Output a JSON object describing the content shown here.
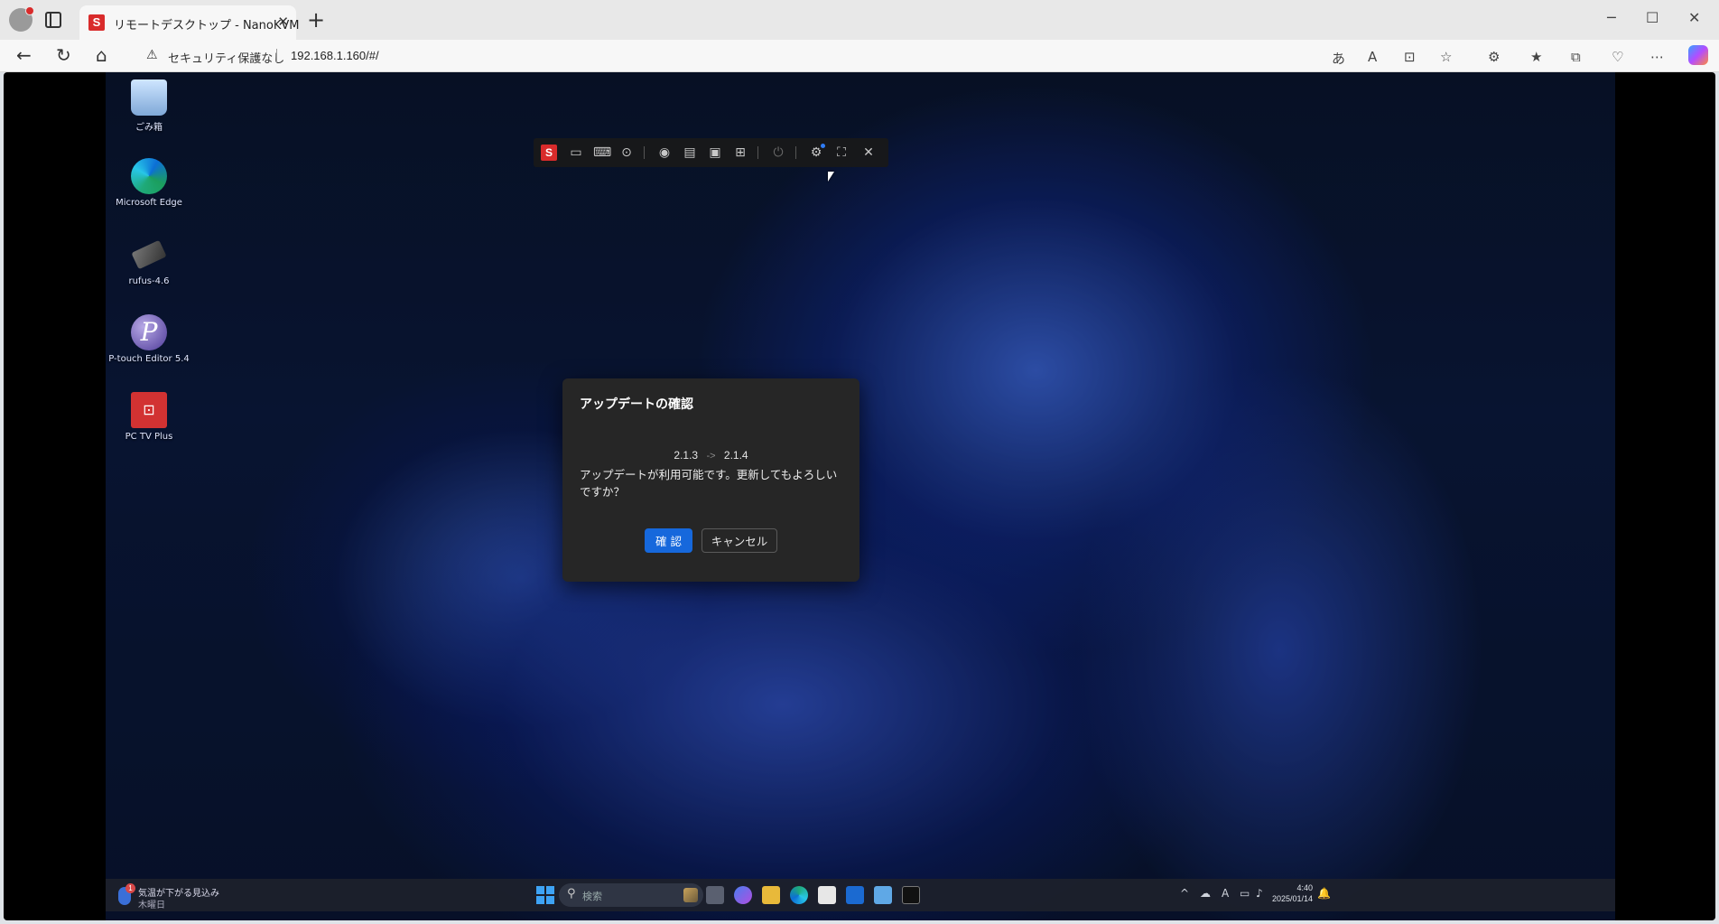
{
  "browser": {
    "tab_title": "リモートデスクトップ - NanoKVM",
    "tab_favicon": "S",
    "security_label": "セキュリティ保護なし",
    "url": "192.168.1.160/#/",
    "accent": "#d92b2b"
  },
  "desktop": {
    "icons": [
      {
        "label": "ごみ箱",
        "icon": "recycle-bin-icon"
      },
      {
        "label": "Microsoft Edge",
        "icon": "edge-icon"
      },
      {
        "label": "rufus-4.6",
        "icon": "usb-icon"
      },
      {
        "label": "P-touch Editor 5.4",
        "icon": "ptouch-icon"
      },
      {
        "label": "PC TV Plus",
        "icon": "tv-icon"
      }
    ]
  },
  "kvm_toolbar": {
    "logo": "S",
    "items": [
      "screen-icon",
      "keyboard-icon",
      "mouse-icon",
      "disk-icon",
      "script-icon",
      "terminal-icon",
      "network-icon",
      "power-icon",
      "settings-icon",
      "fullscreen-icon",
      "close-icon"
    ]
  },
  "dialog": {
    "title": "アップデートの確認",
    "current_version": "2.1.3",
    "arrow": "->",
    "new_version": "2.1.4",
    "message": "アップデートが利用可能です。更新してもよろしいですか？",
    "confirm_label": "確 認",
    "cancel_label": "キャンセル",
    "accent": "#1668dc"
  },
  "taskbar": {
    "weather_badge": "1",
    "weather_line1": "気温が下がる見込み",
    "weather_line2": "木曜日",
    "search_placeholder": "検索",
    "time": "4:40",
    "date": "2025/01/14",
    "ime": "A"
  }
}
